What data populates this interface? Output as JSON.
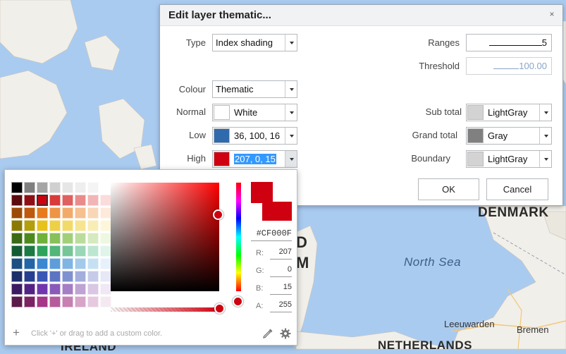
{
  "map": {
    "labels": {
      "denmark": "DENMARK",
      "north_sea": "North Sea",
      "leeuwarden": "Leeuwarden",
      "bremen": "Bremen",
      "netherlands": "NETHERLANDS",
      "ireland": "IRELAND",
      "partial_d": "D",
      "partial_m": "M"
    }
  },
  "dialog": {
    "title": "Edit layer thematic...",
    "close_glyph": "×",
    "type": {
      "label": "Type",
      "value": "Index shading"
    },
    "ranges": {
      "label": "Ranges",
      "value": "5"
    },
    "threshold": {
      "label": "Threshold",
      "value": "100.00"
    },
    "colour": {
      "label": "Colour",
      "value": "Thematic"
    },
    "normal": {
      "label": "Normal",
      "value": "White",
      "swatch": "#ffffff"
    },
    "low": {
      "label": "Low",
      "value": "36, 100, 16",
      "swatch": "#2f6aad"
    },
    "high": {
      "label": "High",
      "value": "207, 0, 15",
      "swatch": "#cf000f"
    },
    "sub_total": {
      "label": "Sub total",
      "value": "LightGray",
      "swatch": "#d3d3d3"
    },
    "grand_total": {
      "label": "Grand total",
      "value": "Gray",
      "swatch": "#808080"
    },
    "boundary": {
      "label": "Boundary",
      "value": "LightGray",
      "swatch": "#d3d3d3"
    },
    "ok_label": "OK",
    "cancel_label": "Cancel"
  },
  "picker": {
    "hex": "#CF000F",
    "channels": [
      {
        "label": "R:",
        "value": "207"
      },
      {
        "label": "G:",
        "value": "0"
      },
      {
        "label": "B:",
        "value": "15"
      },
      {
        "label": "A:",
        "value": "255"
      }
    ],
    "hint": "Click '+' or drag to add a custom color.",
    "plus_glyph": "+",
    "current_color": "#cf000f",
    "palette_rows": [
      [
        "#000000",
        "#7f7f7f",
        "#a5a5a5",
        "#d0d0d0",
        "#e6e6e6",
        "#eeeeee",
        "#f4f4f4",
        "#ffffff"
      ],
      [
        "#5b0a0e",
        "#8e1016",
        "#cf000f",
        "#d93a3a",
        "#e06060",
        "#ea8b8b",
        "#f2b5b5",
        "#fadcdc"
      ],
      [
        "#9c4a08",
        "#c0580d",
        "#e87a1c",
        "#ee9446",
        "#f2aa6a",
        "#f6c090",
        "#f9d6b6",
        "#fdeadb"
      ],
      [
        "#8a7a05",
        "#b39e0b",
        "#e8c21c",
        "#eed046",
        "#f2da6a",
        "#f6e490",
        "#f9edb6",
        "#fdf6db"
      ],
      [
        "#3b6914",
        "#4d8a1d",
        "#6fb13a",
        "#88c05a",
        "#a1cf7a",
        "#bbdd9c",
        "#d5ebbd",
        "#eef7e0"
      ],
      [
        "#145a32",
        "#1c7a43",
        "#2ea35c",
        "#52b57a",
        "#76c698",
        "#9ad7b6",
        "#bde6d1",
        "#e0f4ea"
      ],
      [
        "#1c4f82",
        "#2266a8",
        "#3a87d2",
        "#5d9dda",
        "#80b4e3",
        "#a3caeb",
        "#c6e0f3",
        "#e6f1fb"
      ],
      [
        "#1c2f6b",
        "#273f8e",
        "#3a57b5",
        "#5d74c2",
        "#8091cf",
        "#a3aedc",
        "#c6cbe9",
        "#e6e8f6"
      ],
      [
        "#3c1a62",
        "#522384",
        "#7036ad",
        "#8a5ab9",
        "#a57ec6",
        "#bfa3d4",
        "#d9c7e3",
        "#f0e8f4"
      ],
      [
        "#5c1a4a",
        "#7c2364",
        "#a63686",
        "#b65b9c",
        "#c680b2",
        "#d6a5c8",
        "#e6c9de",
        "#f5e9f1"
      ]
    ]
  }
}
